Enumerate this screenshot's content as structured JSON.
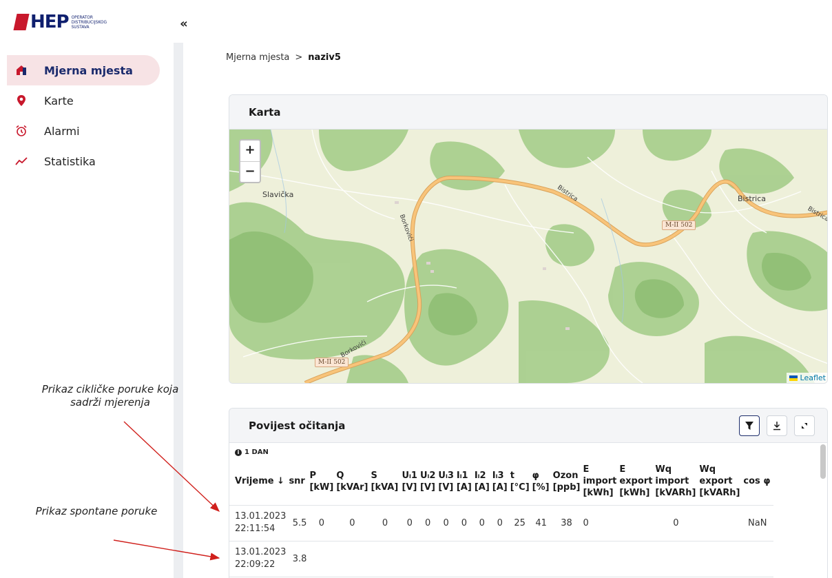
{
  "logo": {
    "brand": "HEP",
    "sub_lines": [
      "OPERATOR",
      "DISTRIBUCIJSKOG",
      "SUSTAVA"
    ]
  },
  "sidebar": {
    "collapse_label": "«",
    "items": [
      {
        "label": "Mjerna mjesta",
        "icon": "home-icon",
        "active": true
      },
      {
        "label": "Karte",
        "icon": "map-pin-icon",
        "active": false
      },
      {
        "label": "Alarmi",
        "icon": "alarm-clock-icon",
        "active": false
      },
      {
        "label": "Statistika",
        "icon": "trend-chart-icon",
        "active": false
      }
    ]
  },
  "breadcrumb": {
    "parent": "Mjerna mjesta",
    "separator": ">",
    "current": "naziv5"
  },
  "map_card": {
    "title": "Karta",
    "zoom_in": "+",
    "zoom_out": "−",
    "attribution": "Leaflet",
    "labels": {
      "slavicka": "Slavička",
      "bistrica": "Bistrica",
      "bistrica_road": "Bistrica",
      "bistrica_road2": "Bistrica",
      "borkovici": "Borkovići",
      "borkovici2": "Borkovići",
      "shield1": "M-II 502",
      "shield2": "M-II 502"
    }
  },
  "history_card": {
    "title": "Povijest očitanja",
    "range_tag": "1 DAN",
    "buttons": [
      "filter-icon",
      "download-icon",
      "expand-icon"
    ],
    "columns": [
      {
        "l1": "Vrijeme ↓",
        "l2": ""
      },
      {
        "l1": "snr",
        "l2": ""
      },
      {
        "l1": "P",
        "l2": "[kW]"
      },
      {
        "l1": "Q",
        "l2": "[kVAr]"
      },
      {
        "l1": "S",
        "l2": "[kVA]"
      },
      {
        "l1": "Uₗ1",
        "l2": "[V]"
      },
      {
        "l1": "Uₗ2",
        "l2": "[V]"
      },
      {
        "l1": "Uₗ3",
        "l2": "[V]"
      },
      {
        "l1": "Iₗ1",
        "l2": "[A]"
      },
      {
        "l1": "Iₗ2",
        "l2": "[A]"
      },
      {
        "l1": "Iₗ3",
        "l2": "[A]"
      },
      {
        "l1": "t",
        "l2": "[°C]"
      },
      {
        "l1": "φ",
        "l2": "[%]"
      },
      {
        "l1": "Ozon",
        "l2": "[ppb]"
      },
      {
        "l1": "E",
        "l2": "import",
        "l3": "[kWh]"
      },
      {
        "l1": "E",
        "l2": "export",
        "l3": "[kWh]"
      },
      {
        "l1": "Wq",
        "l2": "import",
        "l3": "[kVARh]"
      },
      {
        "l1": "Wq",
        "l2": "export",
        "l3": "[kVARh]"
      },
      {
        "l1": "cos φ",
        "l2": ""
      }
    ],
    "rows": [
      {
        "date": "13.01.2023",
        "time": "22:11:54",
        "cells": [
          "5.5",
          "0",
          "0",
          "0",
          "0",
          "0",
          "0",
          "0",
          "0",
          "0",
          "25",
          "41",
          "38",
          "0",
          "",
          "0",
          "",
          "NaN"
        ]
      },
      {
        "date": "13.01.2023",
        "time": "22:09:22",
        "cells": [
          "3.8",
          "",
          "",
          "",
          "",
          "",
          "",
          "",
          "",
          "",
          "",
          "",
          "",
          "",
          "",
          "",
          "",
          ""
        ]
      }
    ]
  },
  "annotations": {
    "cyclic": "Prikaz cikličke poruke koja sadrži mjerenja",
    "spontaneous": "Prikaz spontane poruke"
  },
  "colors": {
    "brand_red": "#c8182c",
    "brand_navy": "#0f1f6e",
    "active_bg": "#f7e3e5",
    "arrow": "#d0201c"
  }
}
